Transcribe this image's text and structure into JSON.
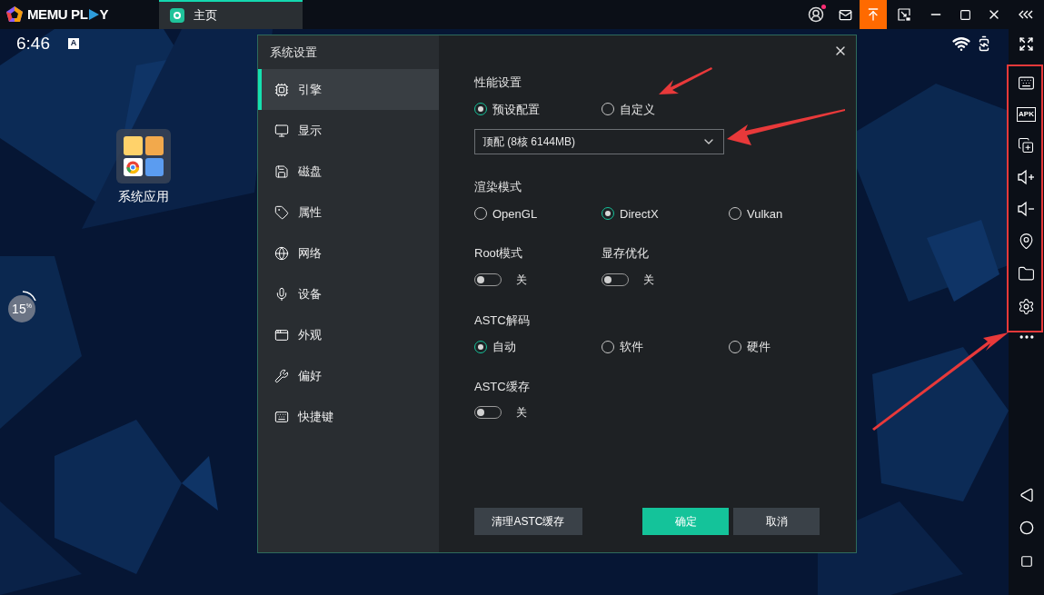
{
  "emulator": {
    "brand": [
      "MEMU PL",
      "Y"
    ],
    "tabs": [
      {
        "label": "主页",
        "selected": true
      }
    ],
    "notification_dot": true
  },
  "android": {
    "time": "6:46",
    "notification_badge": "A",
    "desktop_folder": {
      "label": "系统应用"
    },
    "cpu_widget": {
      "reading": "15",
      "unit": "%"
    }
  },
  "sidebar": {
    "apk_label": "APK"
  },
  "dialog": {
    "title": "系统设置",
    "nav": [
      {
        "label": "引擎",
        "selected": true
      },
      {
        "label": "显示",
        "selected": false
      },
      {
        "label": "磁盘",
        "selected": false
      },
      {
        "label": "属性",
        "selected": false
      },
      {
        "label": "网络",
        "selected": false
      },
      {
        "label": "设备",
        "selected": false
      },
      {
        "label": "外观",
        "selected": false
      },
      {
        "label": "偏好",
        "selected": false
      },
      {
        "label": "快捷键",
        "selected": false
      }
    ],
    "sections": [
      {
        "kind": "radio",
        "label": "性能设置",
        "options": [
          {
            "label": "预设配置",
            "selected": true
          },
          {
            "label": "自定义",
            "selected": false
          }
        ]
      },
      {
        "kind": "select",
        "value": "顶配 (8核 6144MB)"
      },
      {
        "kind": "radio",
        "label": "渲染模式",
        "options": [
          {
            "label": "OpenGL",
            "selected": false
          },
          {
            "label": "DirectX",
            "selected": true
          },
          {
            "label": "Vulkan",
            "selected": false
          }
        ]
      },
      {
        "kind": "toggles",
        "items": [
          {
            "label": "Root模式",
            "on": false,
            "state_label": "关"
          },
          {
            "label": "显存优化",
            "on": false,
            "state_label": "关"
          }
        ]
      },
      {
        "kind": "radio",
        "label": "ASTC解码",
        "options": [
          {
            "label": "自动",
            "selected": true
          },
          {
            "label": "软件",
            "selected": false
          },
          {
            "label": "硬件",
            "selected": false
          }
        ]
      },
      {
        "kind": "toggles",
        "items": [
          {
            "label": "ASTC缓存",
            "on": false,
            "state_label": "关"
          }
        ]
      }
    ],
    "buttons": [
      {
        "label": "清理ASTC缓存",
        "kind": "secondary"
      },
      {
        "label": "确定",
        "kind": "primary"
      },
      {
        "label": "取消",
        "kind": "secondary"
      }
    ]
  }
}
